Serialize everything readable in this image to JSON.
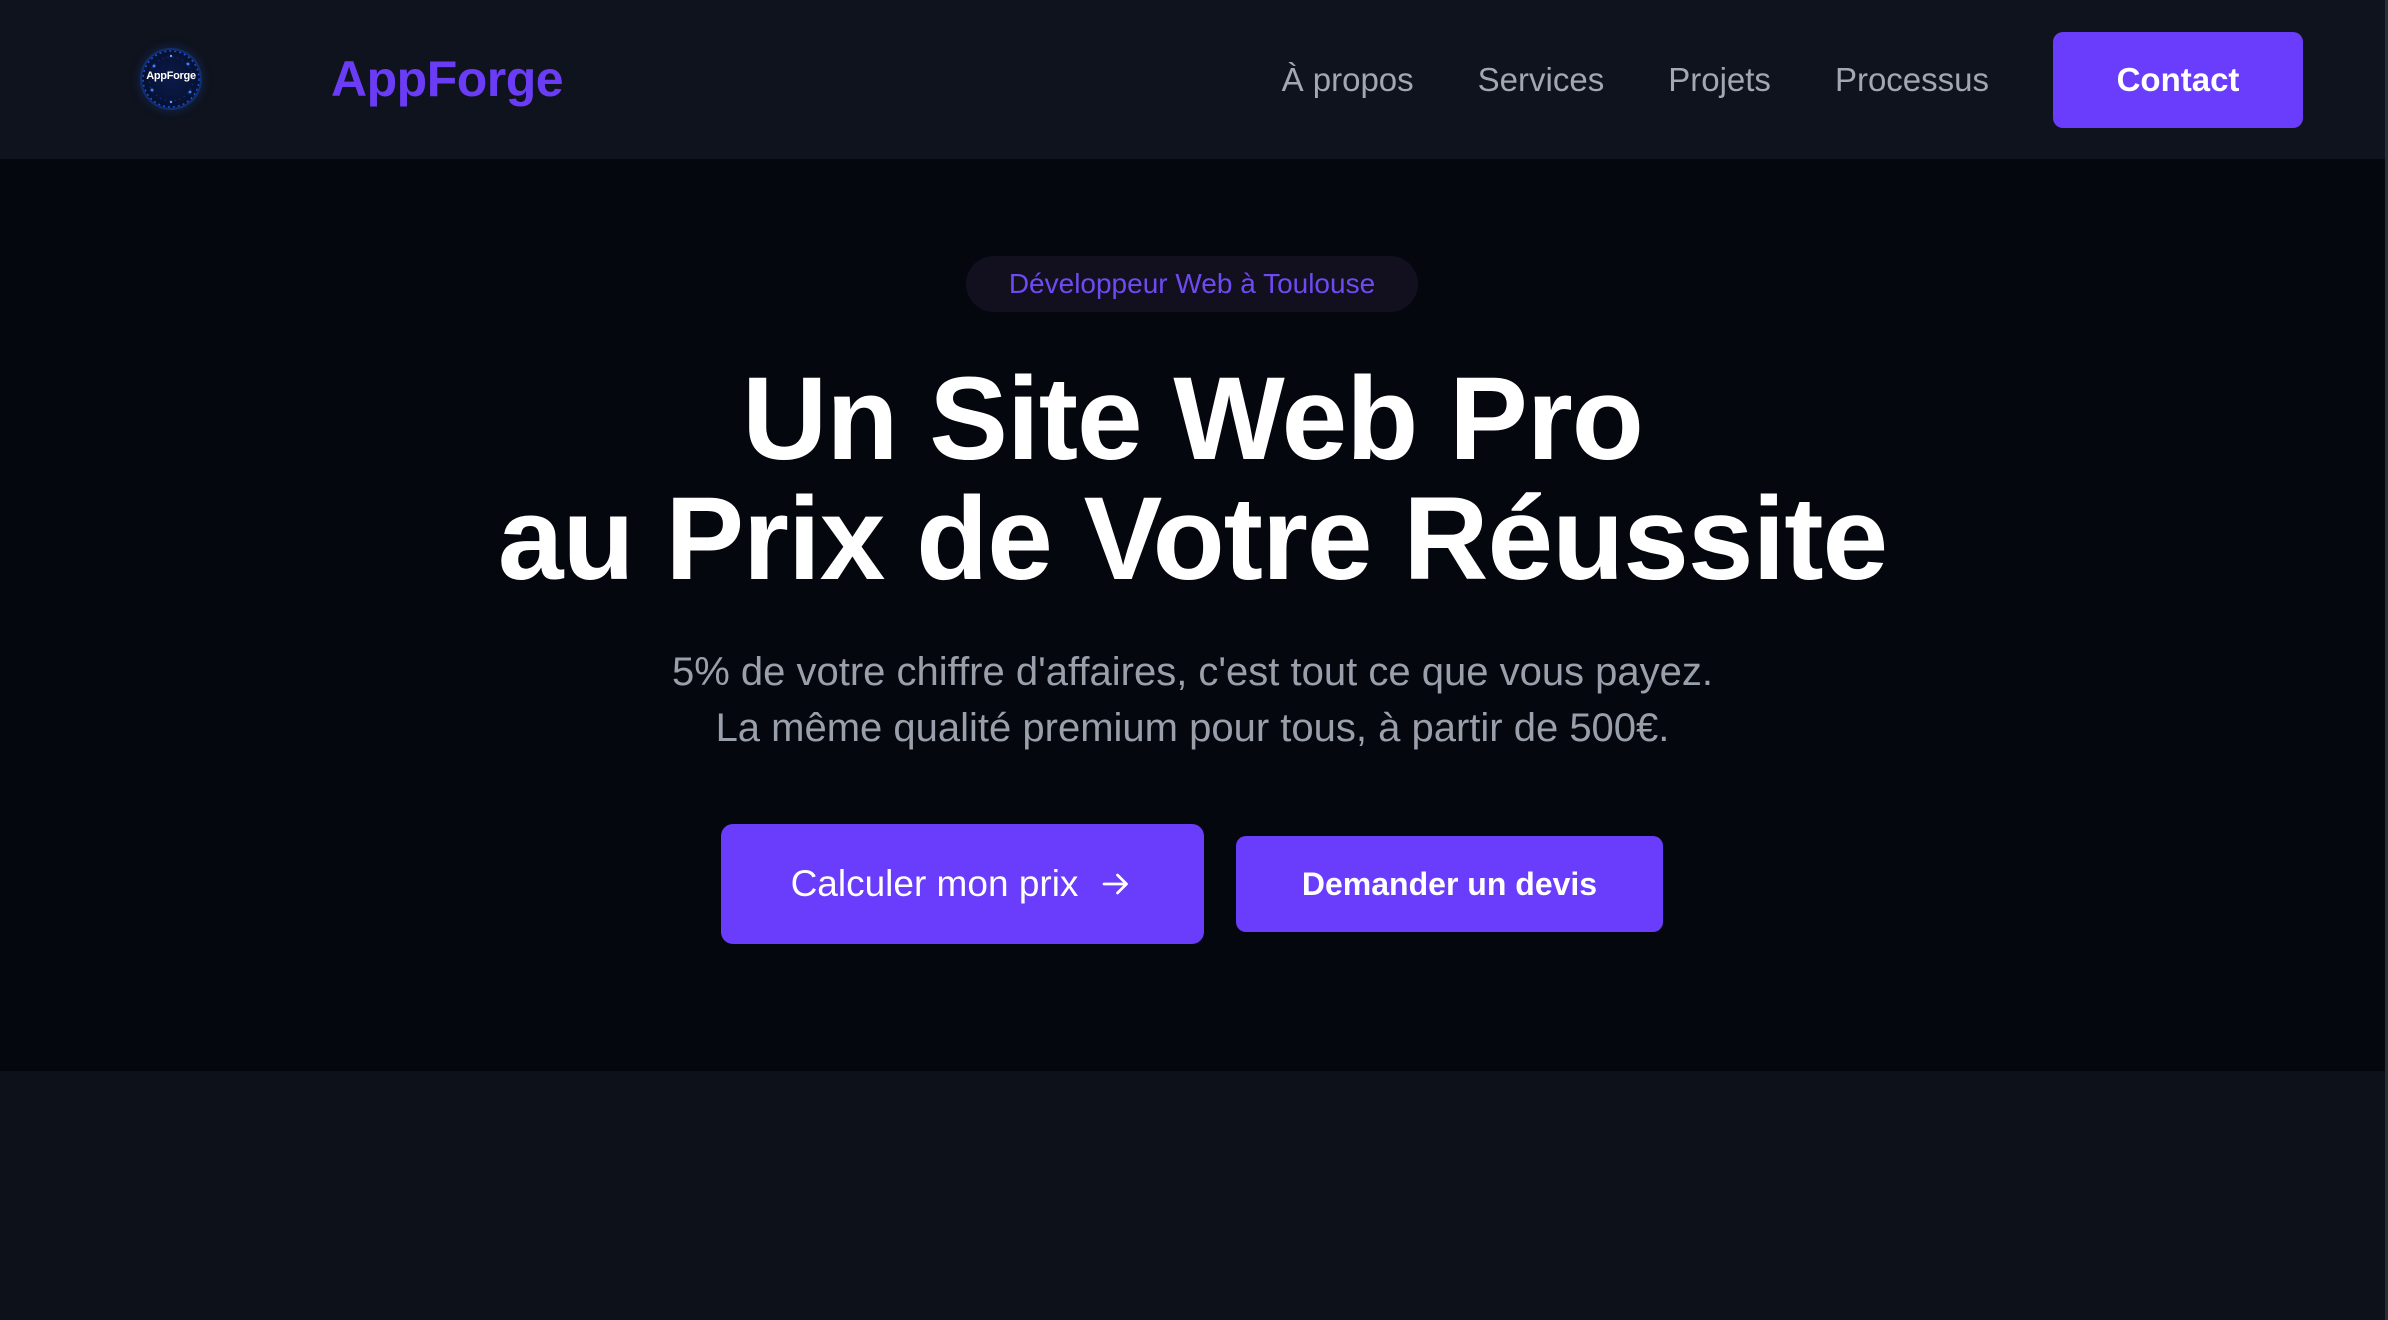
{
  "header": {
    "logo_text": "AppForge",
    "brand": "AppForge",
    "nav": [
      "À propos",
      "Services",
      "Projets",
      "Processus"
    ],
    "contact_label": "Contact"
  },
  "hero": {
    "tag": "Développeur Web à Toulouse",
    "headline_line1": "Un Site Web Pro",
    "headline_line2": "au Prix de Votre Réussite",
    "subtitle_line1": "5% de votre chiffre d'affaires, c'est tout ce que vous payez.",
    "subtitle_line2": "La même qualité premium pour tous, à partir de 500€.",
    "primary_cta": "Calculer mon prix",
    "primary_cta_icon": "arrow-right-icon",
    "secondary_cta": "Demander un devis"
  },
  "colors": {
    "accent": "#6a3cfb",
    "brand_text": "#6b3cf5",
    "nav_bg": "#0f131d",
    "hero_bg": "#04070d",
    "muted_text": "#9aa0ab"
  }
}
